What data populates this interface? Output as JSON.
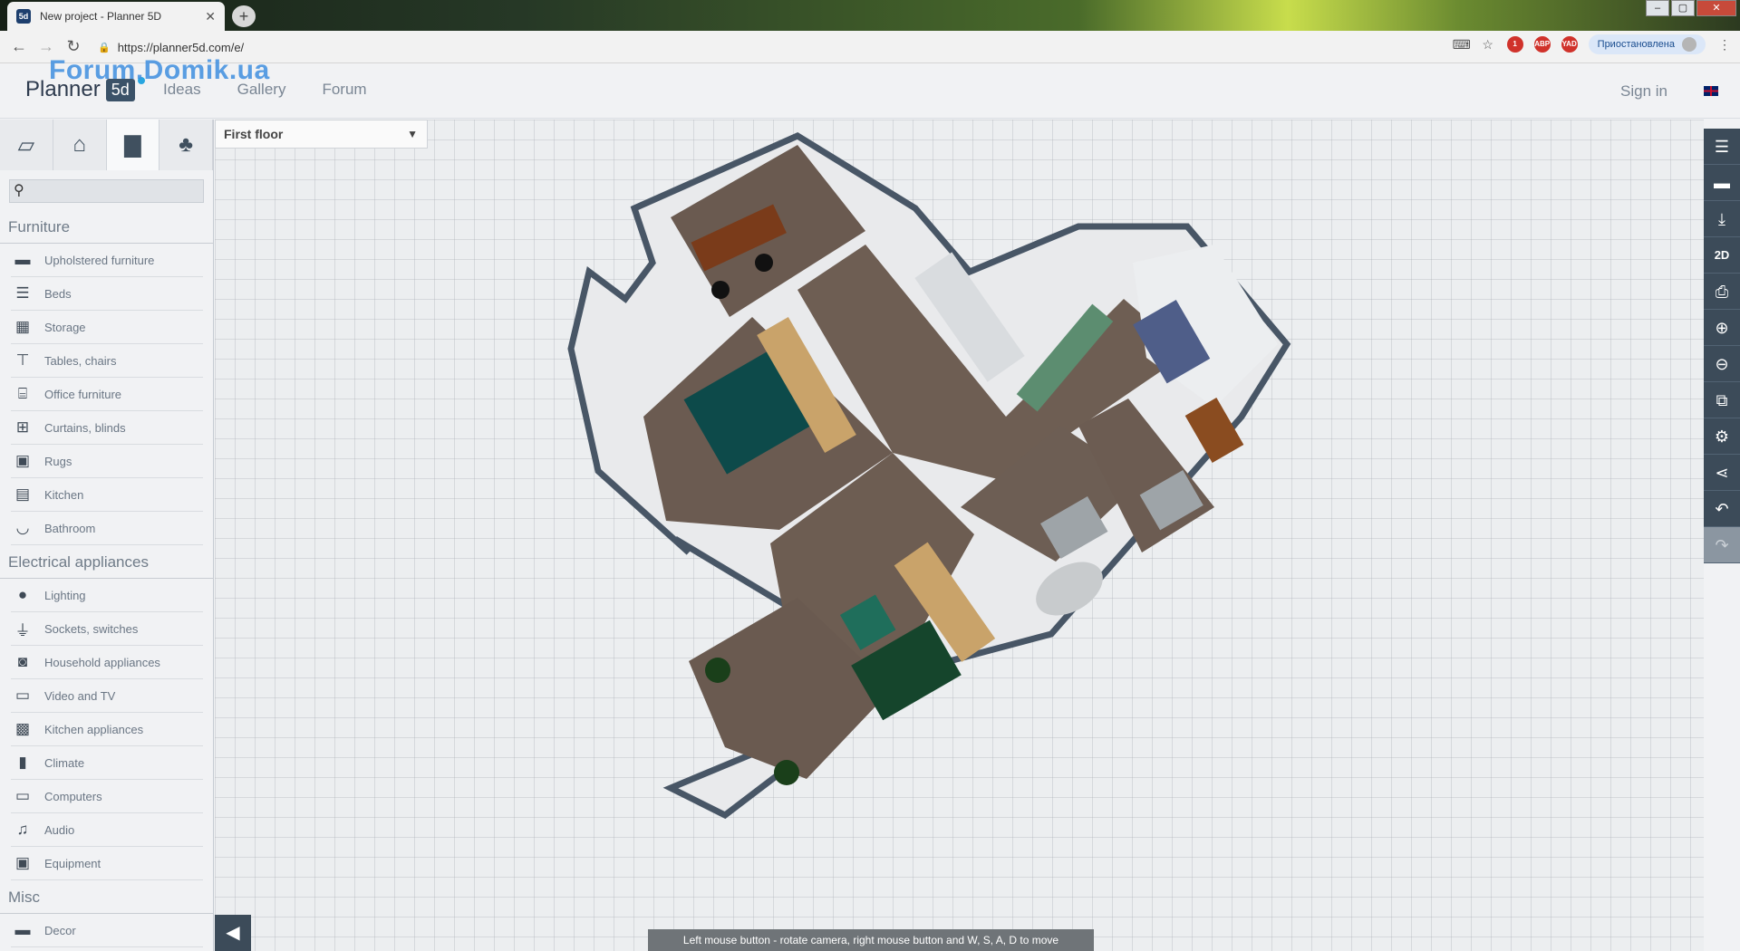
{
  "browser": {
    "tab_title": "New project - Planner 5D",
    "favicon_text": "5d",
    "url": "https://planner5d.com/e/",
    "profile_label": "Приостановлена",
    "badge_text": "1",
    "abp_label": "ABP",
    "yad_label": "YAD"
  },
  "header": {
    "logo_text": "Planner",
    "logo_mark": "5d",
    "watermark": "Forum.Domik.ua",
    "nav": [
      "Ideas",
      "Gallery",
      "Forum"
    ],
    "sign_in": "Sign in",
    "accent": "#28a6e0"
  },
  "panel": {
    "tabs": [
      "plan-icon",
      "home-icon",
      "sofa-icon",
      "tree-icon"
    ],
    "search_placeholder": "",
    "categories": [
      {
        "title": "Furniture",
        "items": [
          {
            "label": "Upholstered furniture",
            "icon": "sofa-icon"
          },
          {
            "label": "Beds",
            "icon": "bed-icon"
          },
          {
            "label": "Storage",
            "icon": "storage-icon"
          },
          {
            "label": "Tables, chairs",
            "icon": "table-icon"
          },
          {
            "label": "Office furniture",
            "icon": "office-icon"
          },
          {
            "label": "Curtains, blinds",
            "icon": "curtain-icon"
          },
          {
            "label": "Rugs",
            "icon": "rug-icon"
          },
          {
            "label": "Kitchen",
            "icon": "kitchen-icon"
          },
          {
            "label": "Bathroom",
            "icon": "bathtub-icon"
          }
        ]
      },
      {
        "title": "Electrical appliances",
        "items": [
          {
            "label": "Lighting",
            "icon": "bulb-icon"
          },
          {
            "label": "Sockets, switches",
            "icon": "plug-icon"
          },
          {
            "label": "Household appliances",
            "icon": "washer-icon"
          },
          {
            "label": "Video and TV",
            "icon": "tv-icon"
          },
          {
            "label": "Kitchen appliances",
            "icon": "stove-icon"
          },
          {
            "label": "Climate",
            "icon": "thermometer-icon"
          },
          {
            "label": "Computers",
            "icon": "computer-icon"
          },
          {
            "label": "Audio",
            "icon": "music-icon"
          },
          {
            "label": "Equipment",
            "icon": "equipment-icon"
          }
        ]
      },
      {
        "title": "Misc",
        "items": [
          {
            "label": "Decor",
            "icon": "decor-icon"
          }
        ]
      }
    ]
  },
  "canvas": {
    "floor": "First floor",
    "hint": "Left mouse button - rotate camera, right mouse button and W, S, A, D to move"
  },
  "right_toolbar": {
    "view_2d_label": "2D"
  }
}
